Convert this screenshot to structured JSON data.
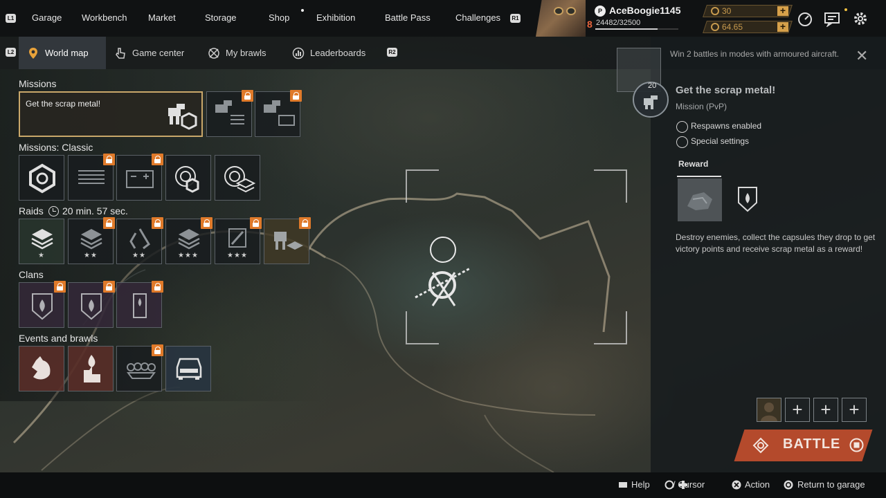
{
  "top_nav": {
    "l1_label": "L1",
    "r1_label": "R1",
    "items": [
      "Garage",
      "Workbench",
      "Market",
      "Storage",
      "Shop",
      "Exhibition",
      "Battle Pass",
      "Challenges"
    ]
  },
  "player": {
    "username": "AceBoogie1145",
    "level": "8",
    "xp_text": "24482/32500",
    "xp_fraction": 0.753,
    "coins": "30",
    "fuel": "64.65"
  },
  "sub_nav": {
    "l2_label": "L2",
    "r2_label": "R2",
    "tabs": [
      "World map",
      "Game center",
      "My brawls",
      "Leaderboards"
    ]
  },
  "missions": {
    "missions_title": "Missions",
    "featured_mission": "Get the scrap metal!",
    "classic_title": "Missions: Classic",
    "raids_title": "Raids",
    "raids_timer": "20 min. 57 sec.",
    "clans_title": "Clans",
    "events_title": "Events and brawls"
  },
  "details": {
    "notification": "Win 2 battles in modes with armoured aircraft.",
    "badge_level": "20",
    "title": "Get the scrap metal!",
    "mode": "Mission (PvP)",
    "feature_1": "Respawns enabled",
    "feature_2": "Special settings",
    "reward_tab": "Reward",
    "description": "Destroy enemies, collect the capsules they drop to get victory points and receive scrap metal as a reward!",
    "battle_label": "BATTLE"
  },
  "bottom_hints": {
    "help": "Help",
    "cursor": "/ Cursor",
    "action": "Action",
    "return": "Return to garage"
  },
  "colors": {
    "accent": "#e07a2a",
    "battle": "#b44a2c",
    "gold": "#caa86a"
  }
}
